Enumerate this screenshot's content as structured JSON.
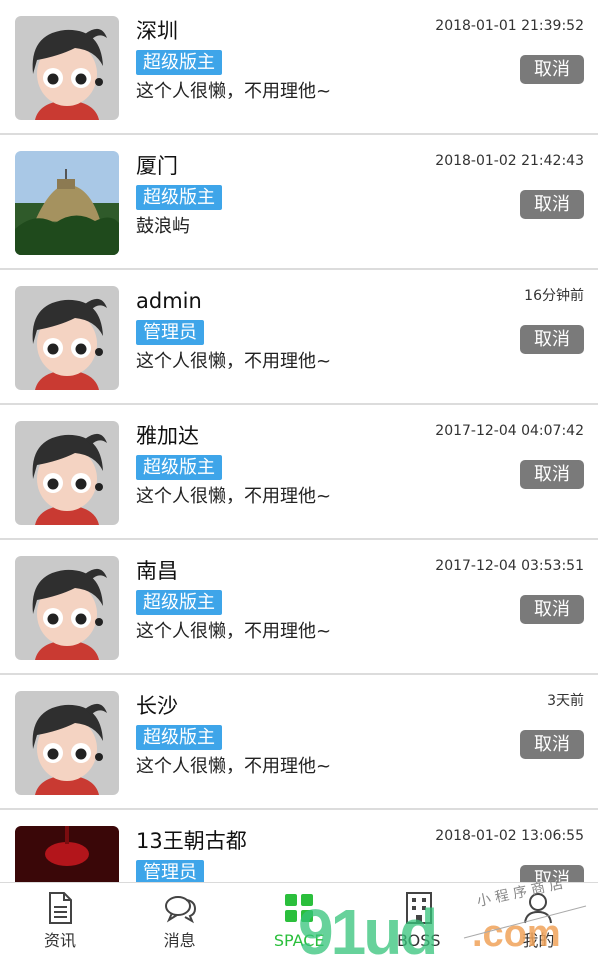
{
  "colors": {
    "accent": "#2bbf3c",
    "badge": "#3ea5e9",
    "cancel_button": "#7a7a7a",
    "separator": "#dcdcdc"
  },
  "items": [
    {
      "name": "深圳",
      "badge": "超级版主",
      "desc": "这个人很懒，不用理他~",
      "time": "2018-01-01 21:39:52",
      "action": "取消",
      "avatar": "cartoon-avatar"
    },
    {
      "name": "厦门",
      "badge": "超级版主",
      "desc": "鼓浪屿",
      "time": "2018-01-02 21:42:43",
      "action": "取消",
      "avatar": "landscape-photo-avatar"
    },
    {
      "name": "admin",
      "badge": "管理员",
      "desc": "这个人很懒，不用理他~",
      "time": "16分钟前",
      "action": "取消",
      "avatar": "cartoon-avatar"
    },
    {
      "name": "雅加达",
      "badge": "超级版主",
      "desc": "这个人很懒，不用理他~",
      "time": "2017-12-04 04:07:42",
      "action": "取消",
      "avatar": "cartoon-avatar"
    },
    {
      "name": "南昌",
      "badge": "超级版主",
      "desc": "这个人很懒，不用理他~",
      "time": "2017-12-04 03:53:51",
      "action": "取消",
      "avatar": "cartoon-avatar"
    },
    {
      "name": "长沙",
      "badge": "超级版主",
      "desc": "这个人很懒，不用理他~",
      "time": "3天前",
      "action": "取消",
      "avatar": "cartoon-avatar"
    },
    {
      "name": "13王朝古都",
      "badge": "管理员",
      "desc": "",
      "time": "2018-01-02 13:06:55",
      "action": "取消",
      "avatar": "red-lantern-photo-avatar"
    }
  ],
  "tabbar": {
    "tabs": [
      {
        "label": "资讯",
        "icon": "document-icon",
        "active": false
      },
      {
        "label": "消息",
        "icon": "chat-bubble-icon",
        "active": false
      },
      {
        "label": "SPACE",
        "icon": "grid-squares-icon",
        "active": true
      },
      {
        "label": "BOSS",
        "icon": "building-icon",
        "active": false
      },
      {
        "label": "我的",
        "icon": "person-icon",
        "active": false
      }
    ]
  },
  "watermark": {
    "text": "91ud.com",
    "subtext": "小程序商店"
  }
}
